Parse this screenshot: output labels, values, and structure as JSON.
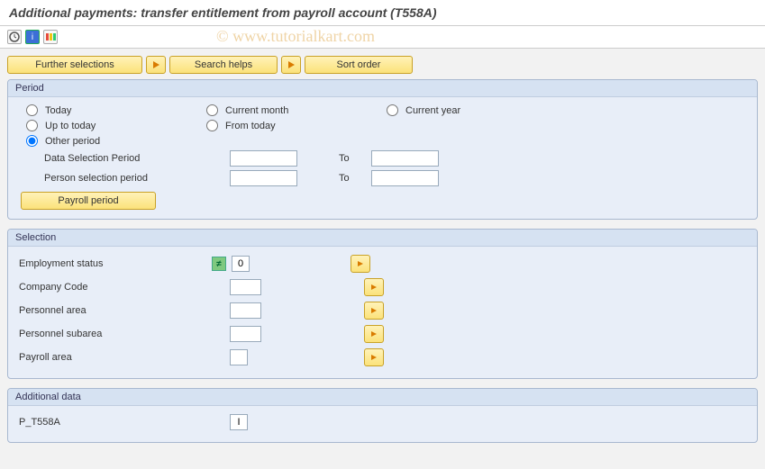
{
  "title": "Additional payments: transfer entitlement from payroll account (T558A)",
  "watermark": "© www.tutorialkart.com",
  "buttons": {
    "further_selections": "Further selections",
    "search_helps": "Search helps",
    "sort_order": "Sort order",
    "payroll_period": "Payroll period"
  },
  "period": {
    "title": "Period",
    "today": "Today",
    "current_month": "Current month",
    "current_year": "Current year",
    "up_to_today": "Up to today",
    "from_today": "From today",
    "other_period": "Other period",
    "data_sel_period": "Data Selection Period",
    "person_sel_period": "Person selection period",
    "to": "To",
    "values": {
      "data_from": "",
      "data_to": "",
      "person_from": "",
      "person_to": ""
    }
  },
  "selection": {
    "title": "Selection",
    "employment_status": "Employment status",
    "employment_status_val": "0",
    "company_code": "Company Code",
    "company_code_val": "",
    "personnel_area": "Personnel area",
    "personnel_area_val": "",
    "personnel_subarea": "Personnel subarea",
    "personnel_subarea_val": "",
    "payroll_area": "Payroll area",
    "payroll_area_val": ""
  },
  "additional": {
    "title": "Additional data",
    "p_t558a": "P_T558A",
    "p_t558a_val": "I"
  }
}
